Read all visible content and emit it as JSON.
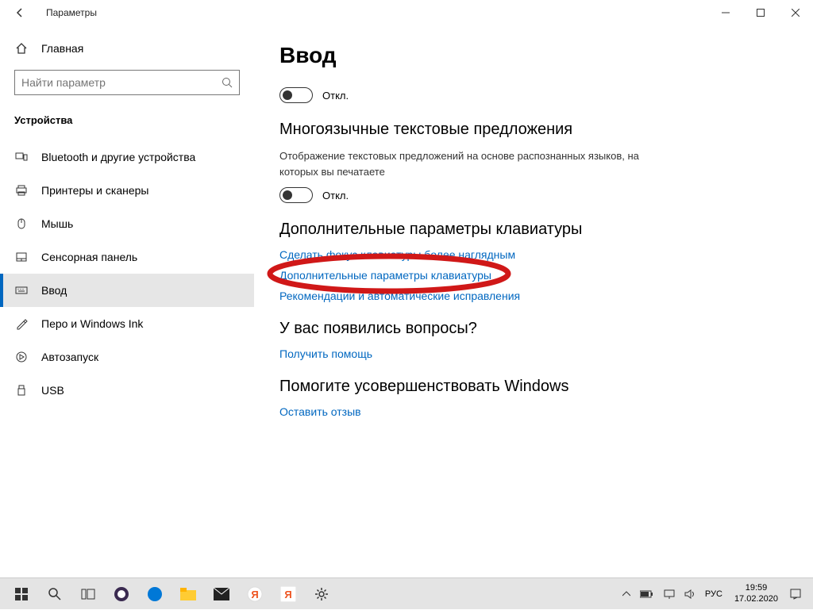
{
  "titlebar": {
    "title": "Параметры"
  },
  "sidebar": {
    "home": "Главная",
    "search_placeholder": "Найти параметр",
    "category": "Устройства",
    "items": [
      {
        "label": "Bluetooth и другие устройства"
      },
      {
        "label": "Принтеры и сканеры"
      },
      {
        "label": "Мышь"
      },
      {
        "label": "Сенсорная панель"
      },
      {
        "label": "Ввод"
      },
      {
        "label": "Перо и Windows Ink"
      },
      {
        "label": "Автозапуск"
      },
      {
        "label": "USB"
      }
    ]
  },
  "main": {
    "page_title": "Ввод",
    "toggle1_label": "Откл.",
    "section_multilang_title": "Многоязычные текстовые предложения",
    "section_multilang_desc": "Отображение текстовых предложений на основе распознанных языков, на которых вы печатаете",
    "toggle2_label": "Откл.",
    "section_advkb_title": "Дополнительные параметры клавиатуры",
    "link_focus": "Сделать фокус клавиатуры более наглядным",
    "link_advkb": "Дополнительные параметры клавиатуры",
    "link_autocorrect": "Рекомендации и автоматические исправления",
    "section_help_title": "У вас появились вопросы?",
    "link_help": "Получить помощь",
    "section_feedback_title": "Помогите усовершенствовать Windows",
    "link_feedback": "Оставить отзыв"
  },
  "taskbar": {
    "lang": "РУС",
    "time": "19:59",
    "date": "17.02.2020"
  }
}
